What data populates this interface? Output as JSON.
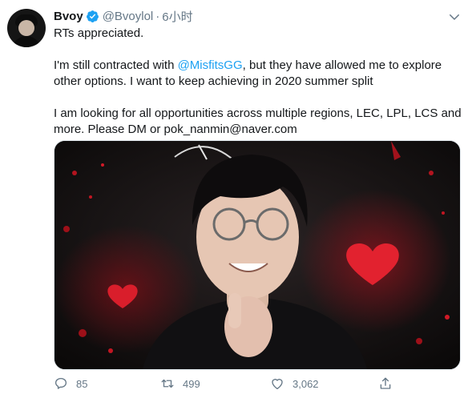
{
  "tweet": {
    "author_name": "Bvoy",
    "author_handle": "@Bvoylol",
    "separator": "·",
    "timestamp": "6小时",
    "line1": "RTs appreciated.",
    "p2_pre": "I'm still contracted with ",
    "p2_mention": "@MisfitsGG",
    "p2_post": ", but they have allowed me to explore other options. I want to keep achieving in 2020 summer split",
    "p3": "I am looking for all opportunities across multiple regions, LEC, LPL, LCS and more. Please DM or pok_nanmin@naver.com"
  },
  "actions": {
    "reply_count": "85",
    "retweet_count": "499",
    "like_count": "3,062"
  },
  "icons": {
    "verified": "verified-badge-icon",
    "caret": "chevron-down-icon",
    "reply": "reply-icon",
    "retweet": "retweet-icon",
    "like": "heart-icon",
    "share": "share-icon"
  },
  "colors": {
    "accent": "#1da1f2",
    "muted": "#657786",
    "text": "#14171a"
  }
}
